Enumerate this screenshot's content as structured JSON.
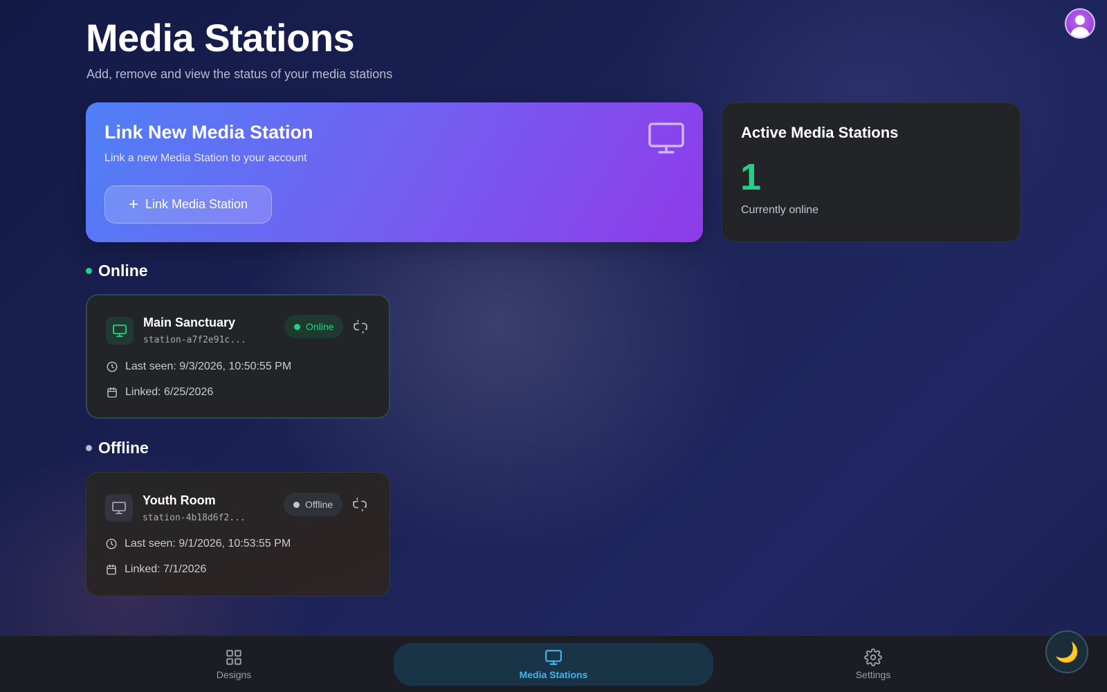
{
  "header": {
    "title": "Media Stations",
    "subtitle": "Add, remove and view the status of your media stations"
  },
  "user": {
    "avatar_icon": "user-avatar-icon"
  },
  "link_card": {
    "title": "Link New Media Station",
    "description": "Link a new Media Station to your account",
    "button_label": "Link Media Station",
    "icon": "monitor-icon"
  },
  "active_card": {
    "title": "Active Media Stations",
    "count": "1",
    "caption": "Currently online"
  },
  "sections": {
    "online": {
      "label": "Online",
      "color": "#25d085",
      "stations": [
        {
          "name": "Main Sanctuary",
          "id": "station-a7f2e91c...",
          "status": "Online",
          "last_seen": "Last seen: 9/3/2026, 10:50:55 PM",
          "linked": "Linked: 6/25/2026"
        }
      ]
    },
    "offline": {
      "label": "Offline",
      "color": "#b8bcc8",
      "stations": [
        {
          "name": "Youth Room",
          "id": "station-4b18d6f2...",
          "status": "Offline",
          "last_seen": "Last seen: 9/1/2026, 10:53:55 PM",
          "linked": "Linked: 7/1/2026"
        }
      ]
    }
  },
  "bottom_nav": {
    "items": [
      {
        "label": "Designs",
        "icon": "grid-icon",
        "active": false
      },
      {
        "label": "Media Stations",
        "icon": "monitor-icon",
        "active": true
      },
      {
        "label": "Settings",
        "icon": "gear-icon",
        "active": false
      }
    ]
  },
  "theme_toggle": {
    "icon": "moon-icon",
    "glyph": "🌙"
  },
  "colors": {
    "accent_online": "#25d085",
    "nav_active": "#3fb6ef",
    "card_gradient_start": "#4f80f7",
    "card_gradient_end": "#8f3be9"
  }
}
